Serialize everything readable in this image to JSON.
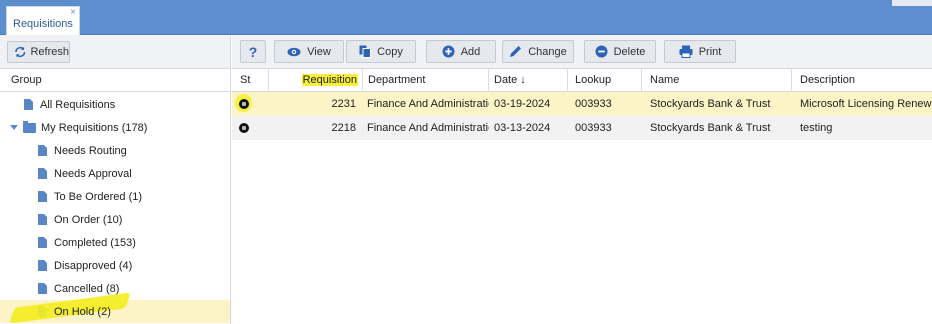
{
  "tabs": [
    {
      "label": "Requisitions",
      "close": "×"
    }
  ],
  "sidebar": {
    "refresh_label": "Refresh",
    "group_header": "Group",
    "items": [
      {
        "label": "All Requisitions"
      },
      {
        "label": "My Requisitions (178)"
      },
      {
        "label": "Needs Routing"
      },
      {
        "label": "Needs Approval"
      },
      {
        "label": "To Be Ordered (1)"
      },
      {
        "label": "On Order (10)"
      },
      {
        "label": "Completed (153)"
      },
      {
        "label": "Disapproved (4)"
      },
      {
        "label": "Cancelled (8)"
      },
      {
        "label": "On Hold (2)"
      }
    ]
  },
  "toolbar": {
    "help_label": "?",
    "view_label": "View",
    "copy_label": "Copy",
    "add_label": "Add",
    "change_label": "Change",
    "delete_label": "Delete",
    "print_label": "Print"
  },
  "table": {
    "columns": [
      "St",
      "Requisition",
      "Department",
      "Date ↓",
      "Lookup",
      "Name",
      "Description"
    ],
    "rows": [
      {
        "requisition": "2231",
        "department": "Finance And Administration",
        "date": "03-19-2024",
        "lookup": "003933",
        "name": "Stockyards Bank & Trust",
        "description": "Microsoft Licensing Renewal"
      },
      {
        "requisition": "2218",
        "department": "Finance And Administration",
        "date": "03-13-2024",
        "lookup": "003933",
        "name": "Stockyards Bank & Trust",
        "description": "testing"
      }
    ]
  },
  "colors": {
    "tabbar": "#5d8fce",
    "accent_blue": "#2d64b6",
    "row_highlight": "#fcf3c6",
    "marker_yellow": "#f4ee22"
  }
}
